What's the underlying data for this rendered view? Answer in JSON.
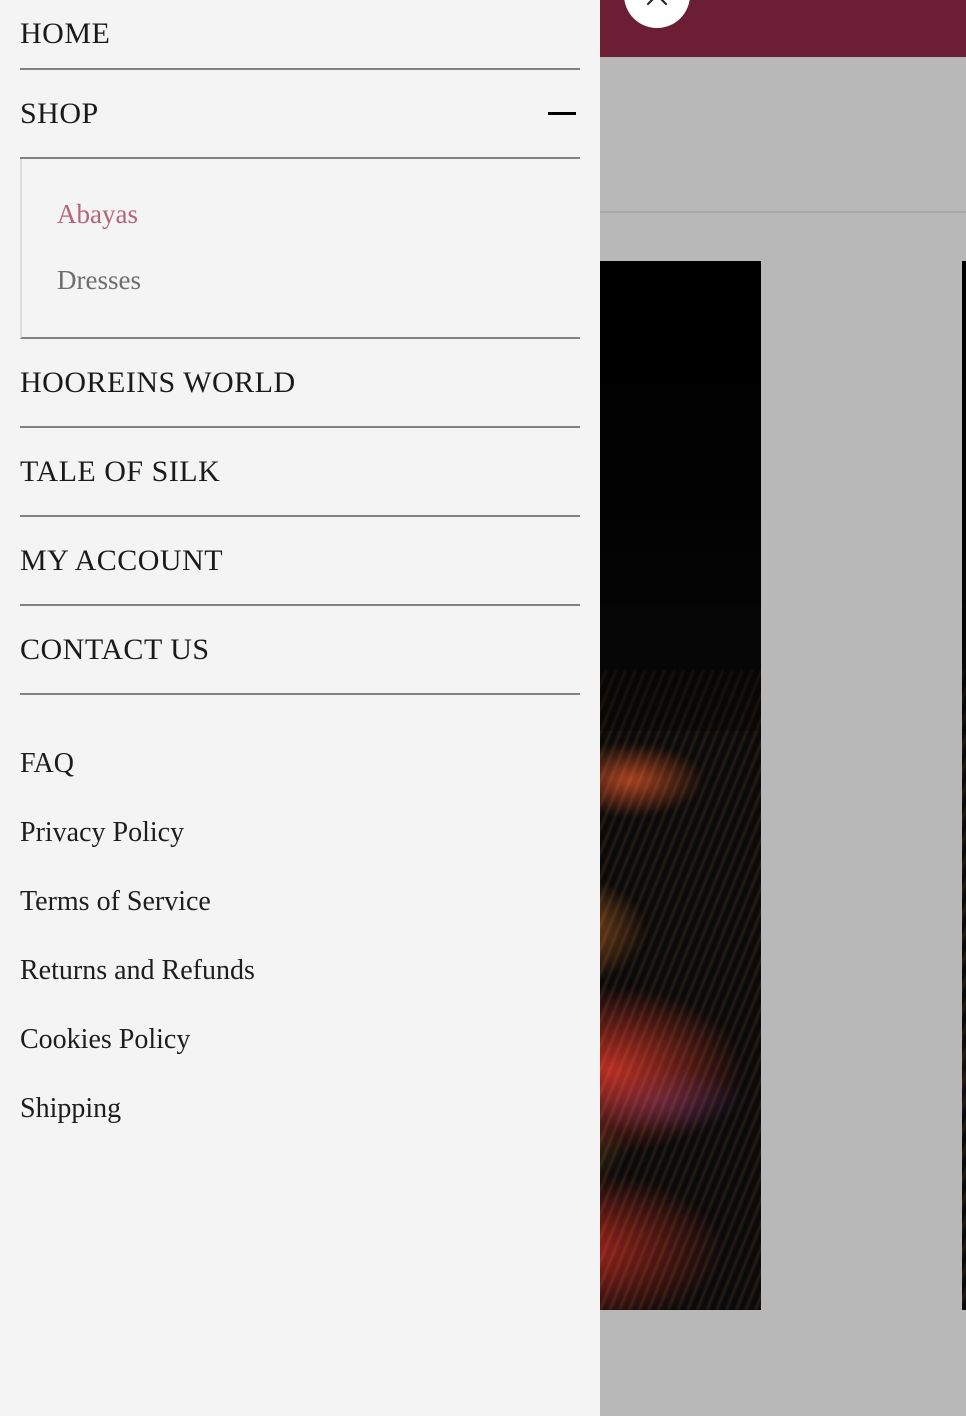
{
  "drawer": {
    "nav": [
      {
        "label": "HOME",
        "icon": null,
        "expanded": false
      },
      {
        "label": "SHOP",
        "icon": "minus-icon",
        "expanded": true
      },
      {
        "label": "HOOREINS WORLD",
        "icon": null,
        "expanded": false
      },
      {
        "label": "TALE OF SILK",
        "icon": null,
        "expanded": false
      },
      {
        "label": "MY ACCOUNT",
        "icon": null,
        "expanded": false
      },
      {
        "label": "CONTACT US",
        "icon": null,
        "expanded": false
      }
    ],
    "shop_submenu": [
      {
        "label": "Abayas",
        "active": true
      },
      {
        "label": "Dresses",
        "active": false
      }
    ],
    "footer_links": [
      {
        "label": "FAQ"
      },
      {
        "label": "Privacy Policy"
      },
      {
        "label": "Terms of Service"
      },
      {
        "label": "Returns and Refunds"
      },
      {
        "label": "Cookies Policy"
      },
      {
        "label": "Shipping"
      }
    ]
  },
  "close_button": {
    "icon": "close-x-icon"
  },
  "colors": {
    "drawer_background": "#f4f4f4",
    "header_maroon": "#6b1e34",
    "page_overlay_gray": "#b8b8b8",
    "active_link_rose": "#b5647c",
    "divider_gray": "#818181",
    "submenu_border": "#dcdcdc",
    "text_dark": "#1a1a1a",
    "product_background": "#0a0a0b"
  }
}
